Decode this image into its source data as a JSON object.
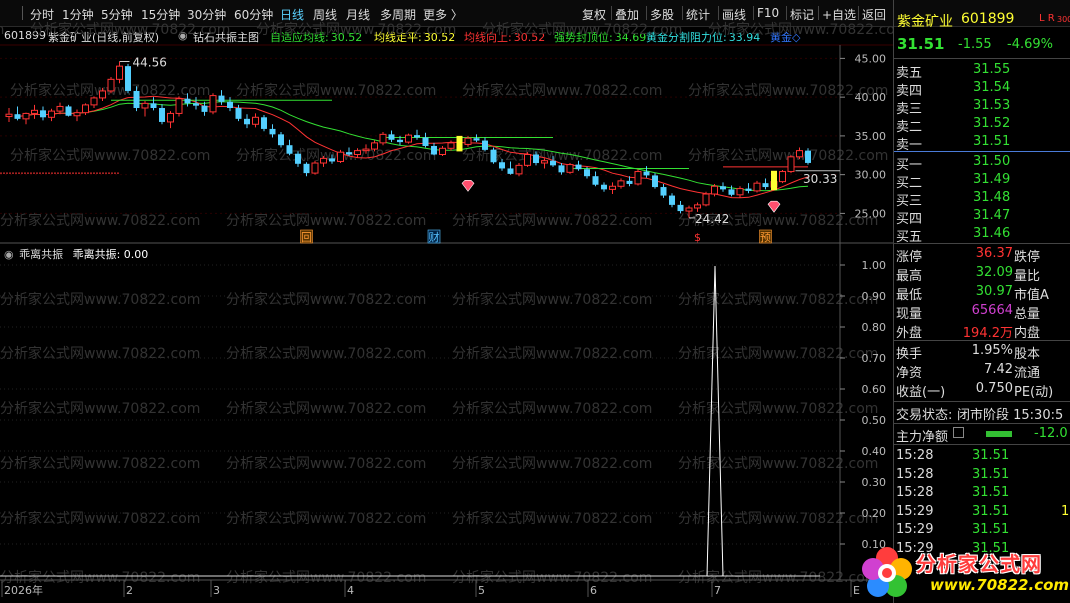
{
  "toolbar": {
    "tabs_left": [
      "分时",
      "1分钟",
      "5分钟",
      "15分钟",
      "30分钟",
      "60分钟",
      "日线",
      "周线",
      "月线",
      "多周期",
      "更多 〉"
    ],
    "active_tab": "日线",
    "tabs_right": [
      "复权",
      "叠加",
      "多股",
      "统计",
      "画线",
      "F10",
      "标记",
      "+自选",
      "返回"
    ]
  },
  "infobar": {
    "code": "601899",
    "stock_title": "紫金矿业(日线,前复权)",
    "indicator_name": "钻石共振主图",
    "items": [
      {
        "label": "自适应均线:",
        "value": "30.52",
        "color": "#33e033"
      },
      {
        "label": "均线走平:",
        "value": "30.52",
        "color": "#ffff33"
      },
      {
        "label": "均线向上:",
        "value": "30.52",
        "color": "#ff3333"
      },
      {
        "label": "强势封顶位:",
        "value": "34.69",
        "color": "#33e033"
      },
      {
        "label": "黄金分割阻力位:",
        "value": "33.94",
        "color": "#33e0e0"
      },
      {
        "label": "黄金◇",
        "value": "",
        "color": "#3377ff"
      }
    ]
  },
  "main_chart": {
    "price_labels": [
      "45.00",
      "40.00",
      "35.00",
      "30.00",
      "25.00"
    ],
    "high_label": "44.56",
    "low_label": "24.42",
    "current_price_label": "30.33",
    "markers": [
      "回",
      "财",
      "$",
      "预"
    ]
  },
  "sub_chart": {
    "title": "乖离共振",
    "value_text": "乖离共振: 0.00",
    "y_labels": [
      "1.00",
      "0.90",
      "0.80",
      "0.70",
      "0.60",
      "0.50",
      "0.40",
      "0.30",
      "0.20",
      "0.10"
    ]
  },
  "x_axis": {
    "labels": [
      "2026年",
      "2",
      "3",
      "4",
      "5",
      "6",
      "7",
      "E"
    ]
  },
  "watermark": "分析家公式网www.70822.com",
  "right_panel": {
    "stock_name": "紫金矿业",
    "stock_code": "601899",
    "flags": "L R",
    "flags_num": "300",
    "price": "31.51",
    "change": "-1.55",
    "change_pct": "-4.69%",
    "sell_orders": [
      {
        "label": "卖五",
        "price": "31.55"
      },
      {
        "label": "卖四",
        "price": "31.54"
      },
      {
        "label": "卖三",
        "price": "31.53"
      },
      {
        "label": "卖二",
        "price": "31.52"
      },
      {
        "label": "卖一",
        "price": "31.51"
      }
    ],
    "buy_orders": [
      {
        "label": "买一",
        "price": "31.50"
      },
      {
        "label": "买二",
        "price": "31.49"
      },
      {
        "label": "买三",
        "price": "31.48"
      },
      {
        "label": "买四",
        "price": "31.47"
      },
      {
        "label": "买五",
        "price": "31.46"
      }
    ],
    "stats": [
      {
        "l1": "涨停",
        "v1": "36.37",
        "c1": "#ff3333",
        "l2": "跌停"
      },
      {
        "l1": "最高",
        "v1": "32.09",
        "c1": "#33e033",
        "l2": "量比"
      },
      {
        "l1": "最低",
        "v1": "30.97",
        "c1": "#33e033",
        "l2": "市值A"
      },
      {
        "l1": "现量",
        "v1": "65664",
        "c1": "#d040d0",
        "l2": "总量"
      },
      {
        "l1": "外盘",
        "v1": "194.2万",
        "c1": "#ff3333",
        "l2": "内盘"
      }
    ],
    "stats2": [
      {
        "l1": "换手",
        "v1": "1.95%",
        "l2": "股本"
      },
      {
        "l1": "净资",
        "v1": "7.42",
        "l2": "流通"
      },
      {
        "l1": "收益(一)",
        "v1": "0.750",
        "l2": "PE(动)"
      }
    ],
    "trade_status_label": "交易状态:",
    "trade_status_value": "闭市阶段 15:30:5",
    "main_net_label": "主力净额",
    "main_net_value": "-12.0",
    "ticks": [
      {
        "time": "15:28",
        "price": "31.51",
        "vol": ""
      },
      {
        "time": "15:28",
        "price": "31.51",
        "vol": ""
      },
      {
        "time": "15:28",
        "price": "31.51",
        "vol": ""
      },
      {
        "time": "15:29",
        "price": "31.51",
        "vol": "1"
      },
      {
        "time": "15:29",
        "price": "31.51",
        "vol": ""
      },
      {
        "time": "15:29",
        "price": "31.51",
        "vol": ""
      }
    ]
  },
  "logo": {
    "text": "分析家公式网",
    "url": "www.70822.com"
  },
  "candles": [
    [
      37.5,
      38.6,
      36.8,
      37.8
    ],
    [
      37.8,
      38.8,
      37.0,
      37.2
    ],
    [
      37.2,
      38.0,
      36.5,
      37.9
    ],
    [
      37.9,
      39.0,
      37.2,
      38.3
    ],
    [
      38.3,
      38.8,
      37.0,
      37.4
    ],
    [
      37.4,
      38.5,
      36.9,
      38.2
    ],
    [
      38.2,
      39.3,
      37.8,
      38.8
    ],
    [
      38.8,
      39.0,
      37.5,
      37.6
    ],
    [
      37.6,
      38.4,
      36.9,
      38.0
    ],
    [
      38.0,
      39.2,
      37.7,
      39.0
    ],
    [
      39.0,
      40.1,
      38.6,
      39.9
    ],
    [
      39.9,
      41.2,
      39.5,
      40.8
    ],
    [
      40.8,
      42.6,
      40.5,
      42.3
    ],
    [
      42.3,
      44.56,
      41.8,
      44.0
    ],
    [
      44.0,
      44.3,
      40.5,
      40.8
    ],
    [
      40.8,
      41.4,
      38.2,
      38.6
    ],
    [
      38.6,
      39.5,
      37.5,
      39.2
    ],
    [
      39.2,
      40.0,
      38.3,
      38.6
    ],
    [
      38.6,
      39.1,
      36.5,
      36.8
    ],
    [
      36.8,
      38.2,
      36.0,
      37.9
    ],
    [
      37.9,
      40.1,
      37.5,
      39.8
    ],
    [
      39.8,
      40.5,
      38.8,
      39.2
    ],
    [
      39.2,
      40.0,
      38.4,
      38.9
    ],
    [
      38.9,
      39.4,
      37.6,
      38.1
    ],
    [
      38.1,
      40.5,
      37.8,
      40.2
    ],
    [
      40.2,
      40.9,
      39.0,
      39.4
    ],
    [
      39.4,
      40.0,
      38.2,
      38.6
    ],
    [
      38.6,
      39.0,
      36.9,
      37.2
    ],
    [
      37.2,
      37.8,
      36.0,
      36.5
    ],
    [
      36.5,
      37.9,
      36.1,
      37.4
    ],
    [
      37.4,
      37.7,
      35.6,
      35.9
    ],
    [
      35.9,
      36.5,
      34.8,
      35.2
    ],
    [
      35.2,
      35.5,
      33.5,
      33.8
    ],
    [
      33.8,
      34.5,
      32.5,
      32.7
    ],
    [
      32.7,
      33.0,
      31.0,
      31.4
    ],
    [
      31.4,
      31.6,
      29.8,
      30.2
    ],
    [
      30.2,
      31.8,
      30.0,
      31.5
    ],
    [
      31.5,
      32.4,
      31.0,
      32.1
    ],
    [
      32.1,
      32.6,
      31.4,
      31.7
    ],
    [
      31.7,
      33.2,
      31.5,
      32.9
    ],
    [
      32.9,
      33.5,
      32.4,
      32.6
    ],
    [
      32.6,
      33.4,
      32.2,
      33.1
    ],
    [
      33.1,
      33.9,
      32.7,
      33.3
    ],
    [
      33.3,
      34.4,
      33.0,
      34.1
    ],
    [
      34.1,
      35.5,
      33.8,
      35.2
    ],
    [
      35.2,
      35.7,
      34.2,
      34.5
    ],
    [
      34.5,
      35.0,
      33.8,
      34.2
    ],
    [
      34.2,
      35.3,
      34.0,
      35.1
    ],
    [
      35.1,
      35.8,
      34.5,
      34.8
    ],
    [
      34.8,
      35.4,
      33.5,
      33.7
    ],
    [
      33.7,
      34.1,
      32.5,
      32.6
    ],
    [
      32.6,
      33.7,
      32.4,
      33.4
    ],
    [
      33.4,
      34.4,
      33.1,
      34.1
    ],
    [
      34.1,
      34.7,
      33.5,
      33.9
    ],
    [
      33.9,
      35.0,
      33.6,
      34.7
    ],
    [
      34.7,
      35.2,
      34.2,
      34.4
    ],
    [
      34.4,
      34.8,
      33.0,
      33.2
    ],
    [
      33.2,
      33.5,
      31.4,
      31.6
    ],
    [
      31.6,
      32.0,
      30.5,
      30.8
    ],
    [
      30.8,
      31.7,
      30.0,
      30.1
    ],
    [
      30.1,
      31.5,
      29.8,
      31.2
    ],
    [
      31.2,
      32.9,
      31.0,
      32.6
    ],
    [
      32.6,
      33.0,
      31.2,
      31.5
    ],
    [
      31.5,
      32.1,
      30.8,
      31.8
    ],
    [
      31.8,
      32.4,
      31.0,
      31.2
    ],
    [
      31.2,
      31.5,
      30.0,
      30.3
    ],
    [
      30.3,
      31.5,
      30.1,
      31.3
    ],
    [
      31.3,
      31.8,
      30.5,
      30.7
    ],
    [
      30.7,
      31.0,
      29.5,
      29.8
    ],
    [
      29.8,
      30.4,
      28.5,
      28.7
    ],
    [
      28.7,
      29.0,
      27.8,
      28.1
    ],
    [
      28.1,
      29.0,
      27.5,
      28.5
    ],
    [
      28.5,
      29.5,
      28.2,
      29.2
    ],
    [
      29.2,
      29.8,
      28.5,
      28.8
    ],
    [
      28.8,
      30.7,
      28.6,
      30.4
    ],
    [
      30.4,
      31.1,
      29.6,
      29.9
    ],
    [
      29.9,
      30.2,
      28.2,
      28.4
    ],
    [
      28.4,
      28.8,
      27.0,
      27.3
    ],
    [
      27.3,
      27.6,
      25.8,
      26.1
    ],
    [
      26.1,
      26.6,
      25.0,
      25.3
    ],
    [
      25.3,
      26.0,
      24.42,
      25.7
    ],
    [
      25.7,
      26.4,
      25.2,
      26.1
    ],
    [
      26.1,
      27.8,
      25.9,
      27.5
    ],
    [
      27.5,
      28.8,
      27.2,
      28.5
    ],
    [
      28.5,
      29.0,
      27.8,
      28.1
    ],
    [
      28.1,
      28.6,
      27.2,
      27.4
    ],
    [
      27.4,
      28.5,
      27.0,
      28.2
    ],
    [
      28.2,
      28.9,
      27.6,
      27.9
    ],
    [
      27.9,
      29.2,
      27.7,
      28.9
    ],
    [
      28.9,
      29.5,
      28.1,
      28.4
    ],
    [
      28.4,
      29.4,
      28.2,
      29.1
    ],
    [
      29.1,
      30.6,
      28.9,
      30.4
    ],
    [
      30.4,
      32.5,
      30.2,
      32.3
    ],
    [
      32.3,
      33.5,
      32.0,
      33.1
    ],
    [
      33.1,
      33.4,
      31.3,
      31.51
    ]
  ]
}
